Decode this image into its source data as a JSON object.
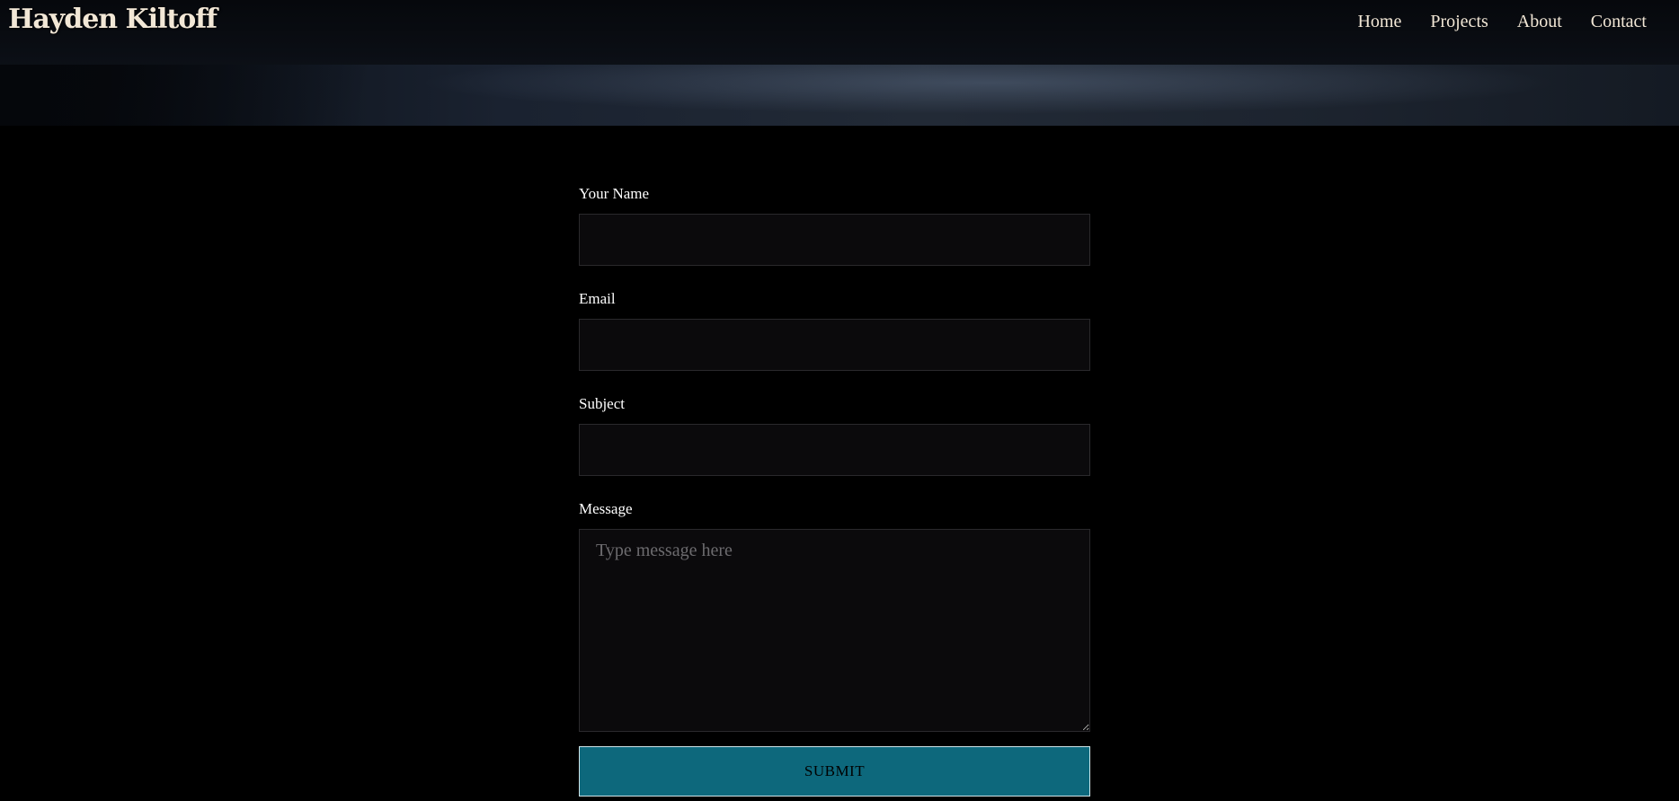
{
  "header": {
    "logo": "Hayden Kiltoff",
    "nav": [
      "Home",
      "Projects",
      "About",
      "Contact"
    ]
  },
  "form": {
    "name_label": "Your Name",
    "name_value": "",
    "email_label": "Email",
    "email_value": "",
    "subject_label": "Subject",
    "subject_value": "",
    "message_label": "Message",
    "message_placeholder": "Type message here",
    "submit_label": "SUBMIT"
  },
  "colors": {
    "background": "#000000",
    "accent": "#0d687c",
    "logo_text": "#f2e7d6"
  }
}
